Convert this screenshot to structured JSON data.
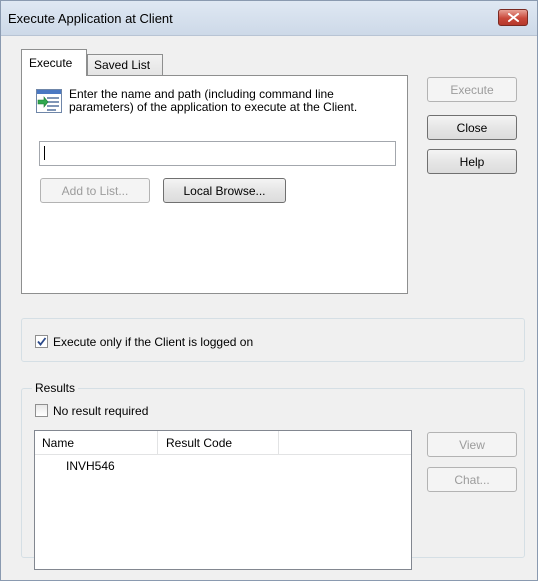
{
  "window": {
    "title": "Execute Application at Client"
  },
  "tabs": {
    "execute": "Execute",
    "saved_list": "Saved List"
  },
  "execute_tab": {
    "description": "Enter the name and path (including command line parameters) of the application to execute at the Client.",
    "path_value": "",
    "add_to_list": "Add to List...",
    "local_browse": "Local Browse..."
  },
  "buttons": {
    "execute": "Execute",
    "close": "Close",
    "help": "Help",
    "view": "View",
    "chat": "Chat..."
  },
  "options": {
    "logged_on_label": "Execute only if the Client is logged on",
    "logged_on_checked": true
  },
  "results": {
    "group_label": "Results",
    "no_result_label": "No result required",
    "no_result_checked": false,
    "columns": [
      "Name",
      "Result Code"
    ],
    "rows": [
      {
        "name": "INVH546",
        "result_code": ""
      }
    ]
  }
}
